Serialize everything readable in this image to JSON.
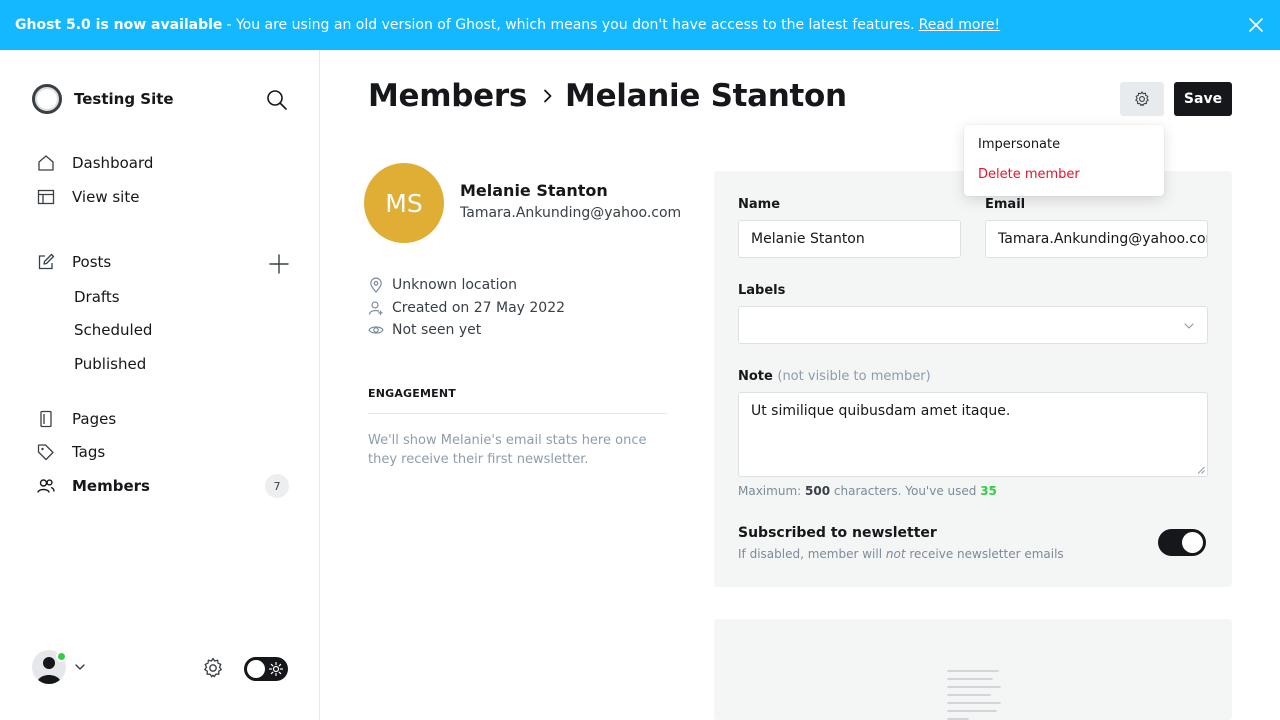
{
  "banner": {
    "headline": "Ghost 5.0 is now available",
    "message": "- You are using an old version of Ghost, which means you don't have access to the latest features.",
    "link": "Read more!"
  },
  "sidebar": {
    "site_name": "Testing Site",
    "nav": {
      "dashboard": "Dashboard",
      "view_site": "View site",
      "posts": "Posts",
      "drafts": "Drafts",
      "scheduled": "Scheduled",
      "published": "Published",
      "pages": "Pages",
      "tags": "Tags",
      "members": "Members",
      "members_count": "7"
    }
  },
  "header": {
    "breadcrumb_parent": "Members",
    "breadcrumb_current": "Melanie Stanton",
    "save_label": "Save"
  },
  "menu": {
    "impersonate": "Impersonate",
    "delete": "Delete member"
  },
  "member": {
    "initials": "MS",
    "name": "Melanie Stanton",
    "email": "Tamara.Ankunding@yahoo.com",
    "location": "Unknown location",
    "created": "Created on 27 May 2022",
    "seen": "Not seen yet",
    "avatar_color": "#e0ae34"
  },
  "engagement": {
    "heading": "ENGAGEMENT",
    "text": "We'll show Melanie's email stats here once they receive their first newsletter."
  },
  "form": {
    "name_label": "Name",
    "name_value": "Melanie Stanton",
    "email_label": "Email",
    "email_value": "Tamara.Ankunding@yahoo.com",
    "labels_label": "Labels",
    "note_label": "Note",
    "note_hint": "(not visible to member)",
    "note_value": "Ut similique quibusdam amet itaque.",
    "counter_prefix": "Maximum:",
    "counter_max": "500",
    "counter_mid": "characters. You've used",
    "counter_used": "35",
    "newsletter_title": "Subscribed to newsletter",
    "newsletter_desc_a": "If disabled, member will",
    "newsletter_desc_em": "not",
    "newsletter_desc_b": "receive newsletter emails",
    "newsletter_enabled": true
  },
  "colors": {
    "banner": "#14b8ff",
    "danger": "#e5162b",
    "success": "#30cf43",
    "dark": "#15171a"
  }
}
